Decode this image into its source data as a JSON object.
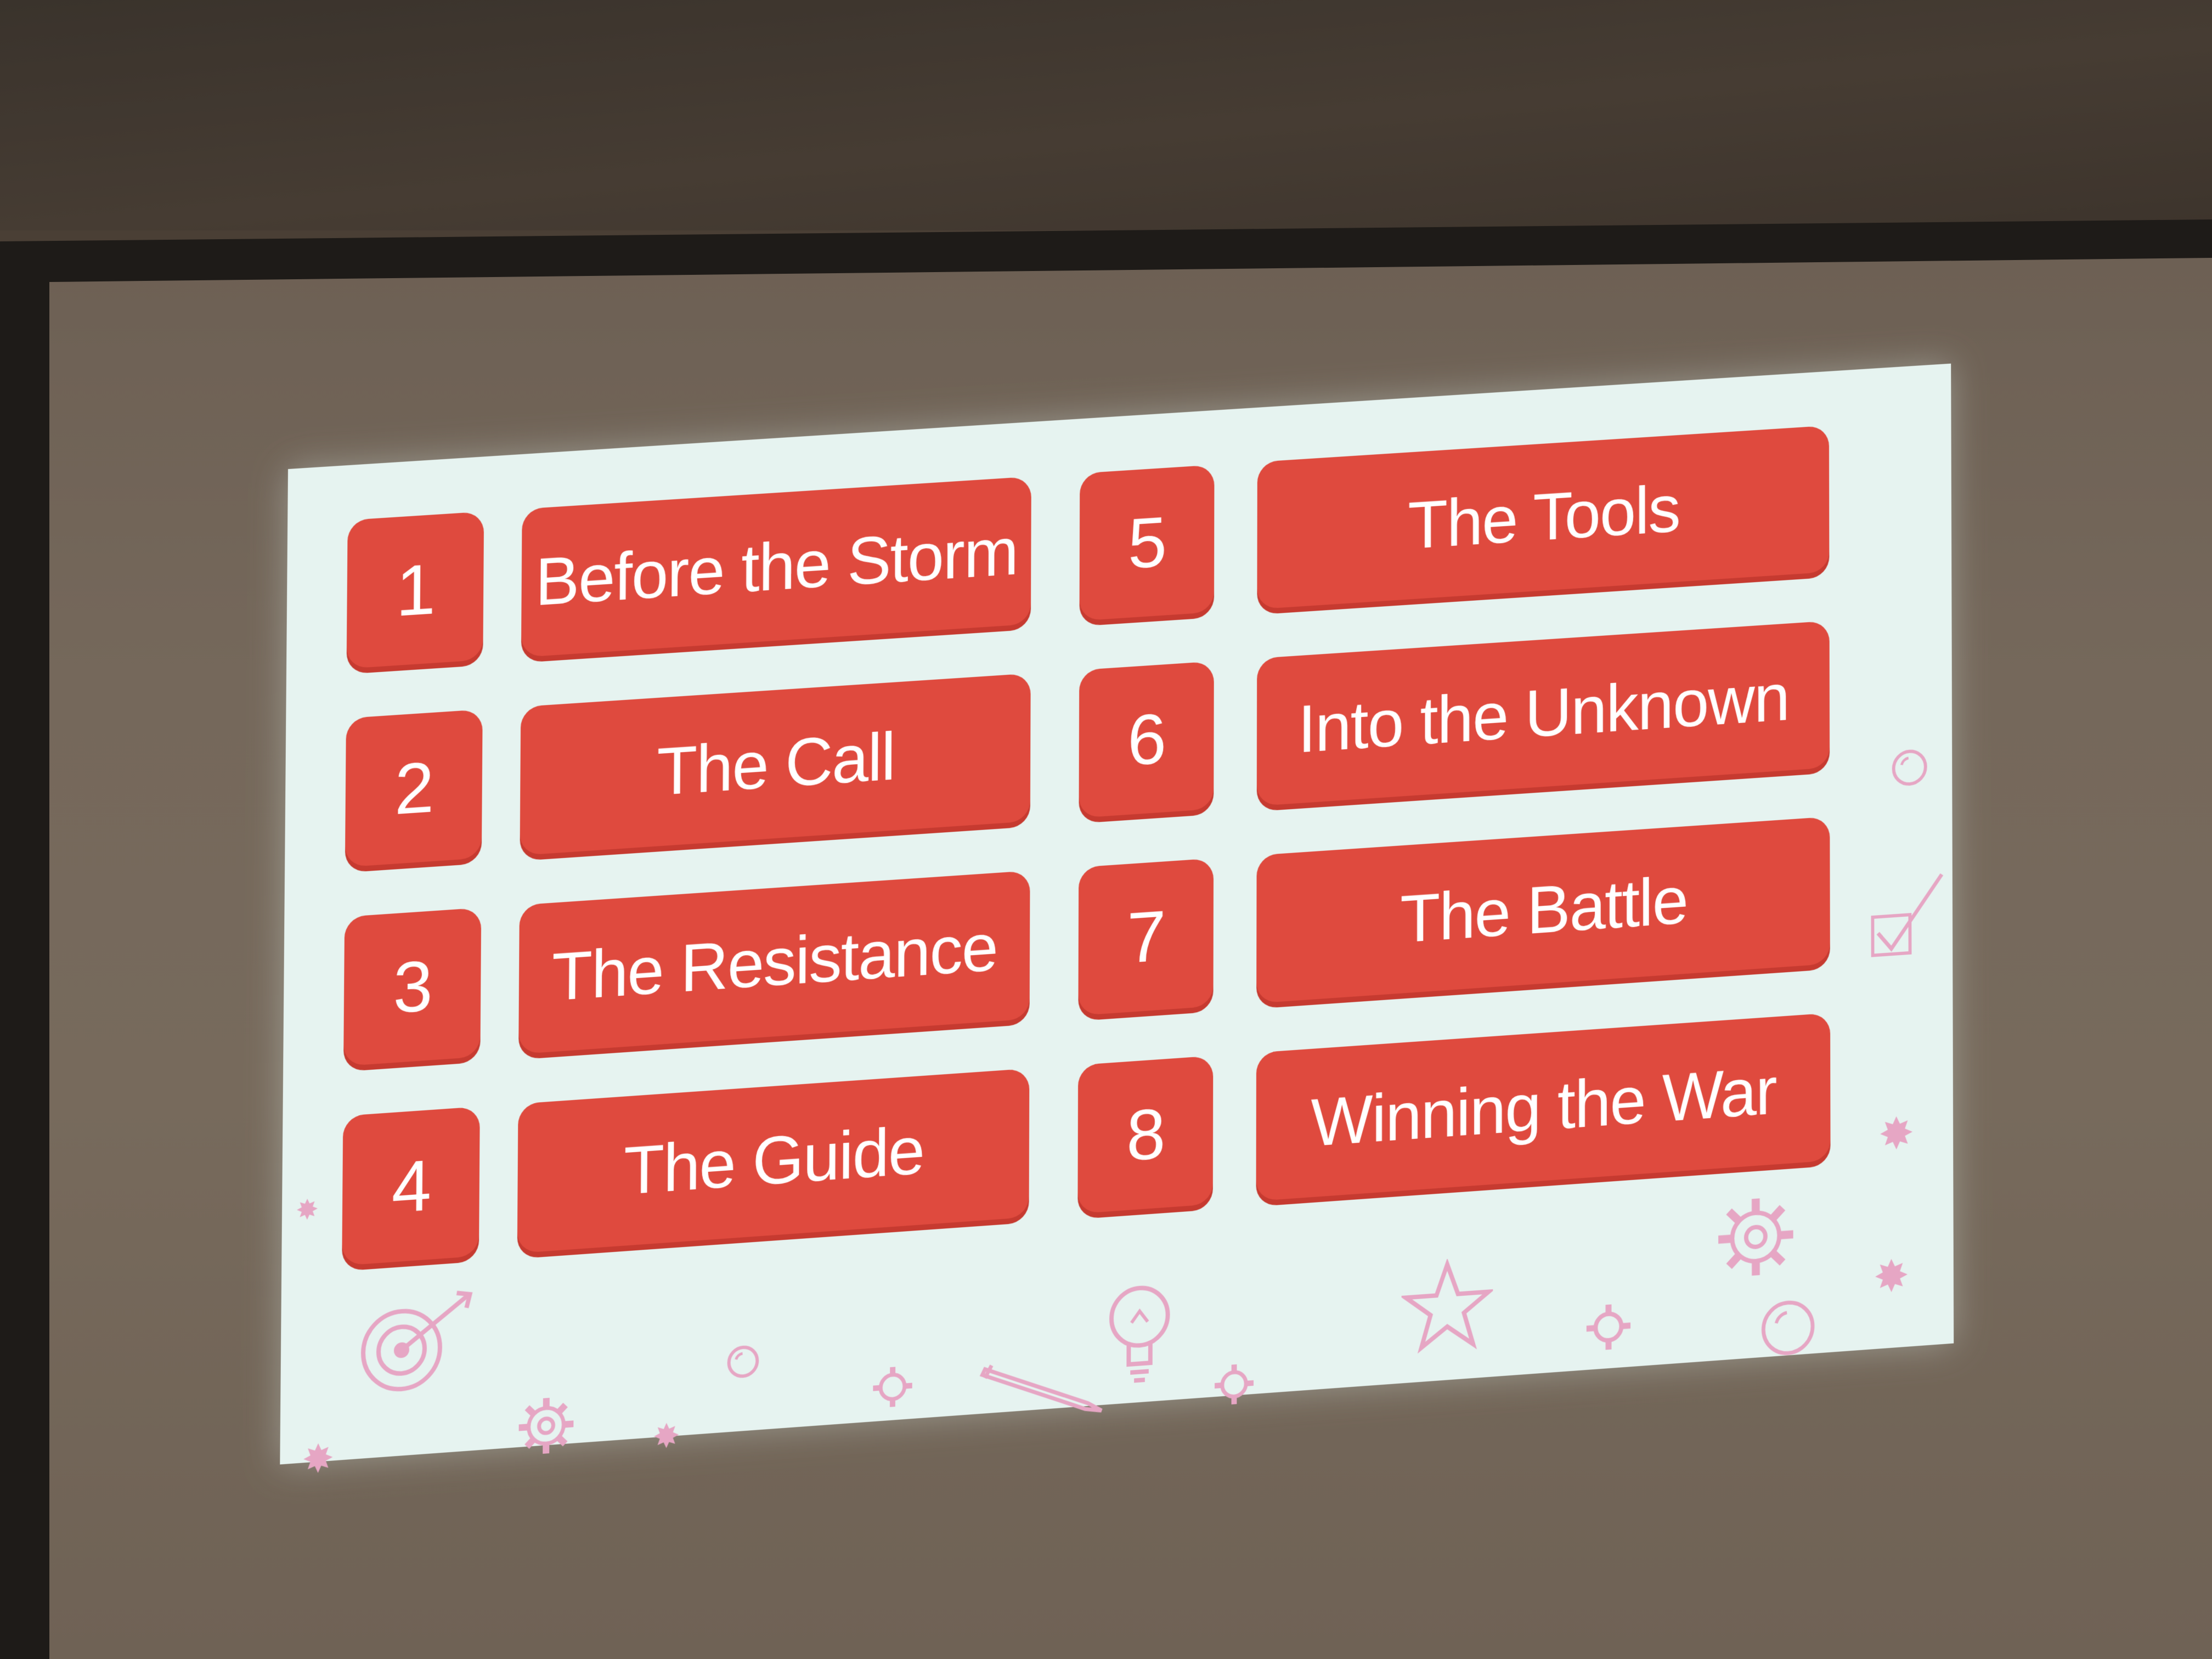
{
  "slide": {
    "items": [
      {
        "number": "1",
        "label": "Before the Storm"
      },
      {
        "number": "2",
        "label": "The Call"
      },
      {
        "number": "3",
        "label": "The Resistance"
      },
      {
        "number": "4",
        "label": "The Guide"
      },
      {
        "number": "5",
        "label": "The Tools"
      },
      {
        "number": "6",
        "label": "Into the Unknown"
      },
      {
        "number": "7",
        "label": "The Battle"
      },
      {
        "number": "8",
        "label": "Winning the War"
      }
    ],
    "decorations": [
      "target-icon",
      "gear-icon",
      "star-icon",
      "lightbulb-icon",
      "pencil-icon",
      "checkbox-icon",
      "bubble-icon"
    ]
  },
  "colors": {
    "box_red": "#df4a3e",
    "box_text": "#ffffff",
    "slide_background": "#e6f3f0",
    "decoration_pink": "#e6a6c4",
    "wall_brown": "#4f443a"
  }
}
